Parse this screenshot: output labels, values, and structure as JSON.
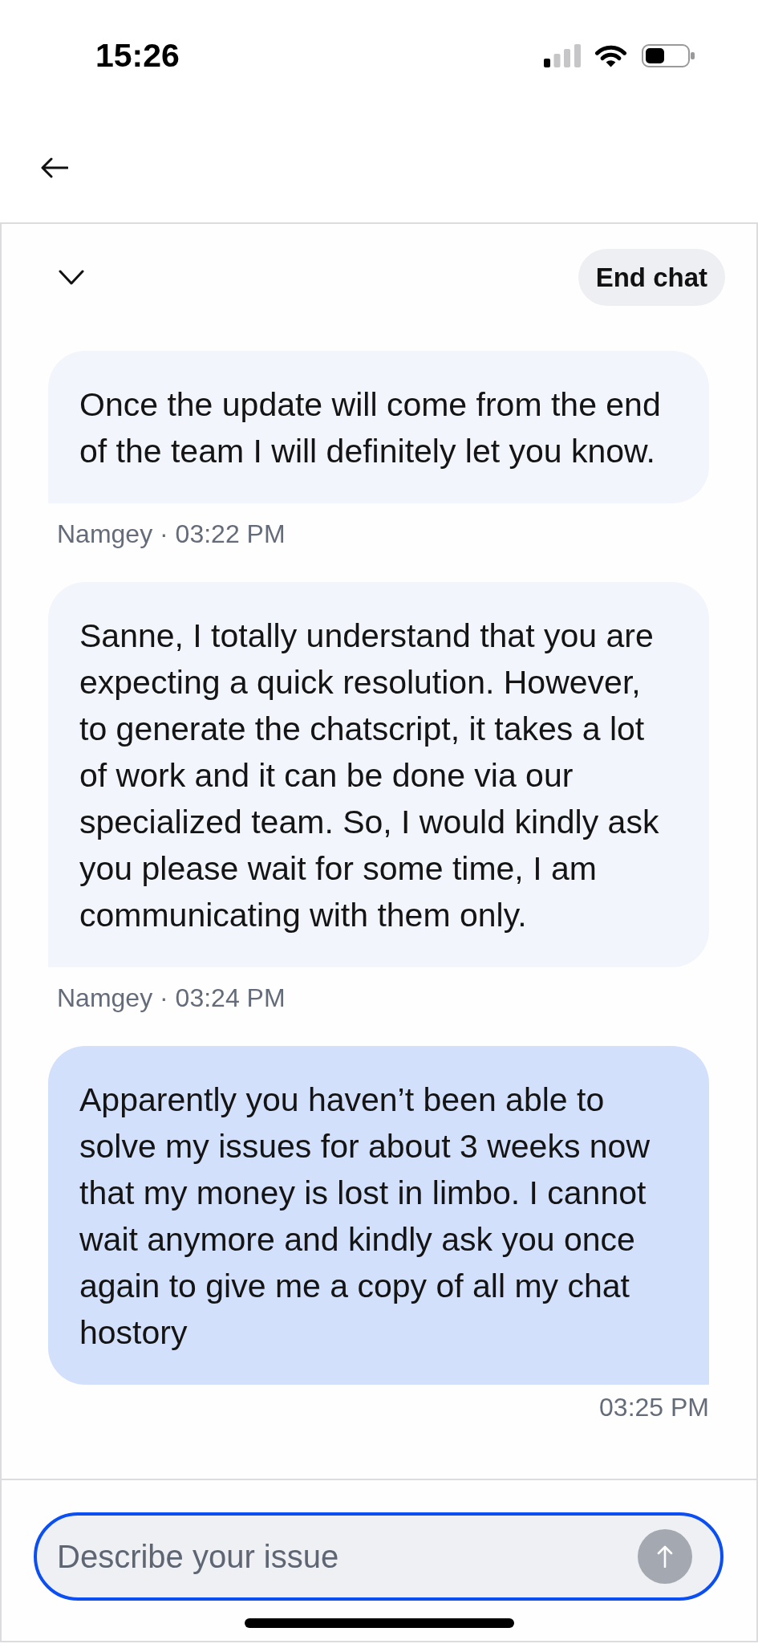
{
  "status_bar": {
    "time": "15:26"
  },
  "chat": {
    "end_button": "End chat"
  },
  "messages": [
    {
      "kind": "received",
      "text": "Once the update will come from the end of the team I will definitely let you know.",
      "meta": "Namgey · 03:22 PM"
    },
    {
      "kind": "received",
      "text": "Sanne, I totally understand that you are expecting a quick resolution. However, to generate the chatscript, it takes a lot of work and it can be done via our specialized team. So, I would kindly ask you please wait for some time, I am communicating with them only.",
      "meta": "Namgey · 03:24 PM"
    },
    {
      "kind": "sent",
      "text": "Apparently you haven’t been able to solve my issues for about 3 weeks now that my money is lost in limbo. I cannot wait anymore and kindly ask you once again to give me a copy of all my chat hostory",
      "meta": "03:25 PM"
    }
  ],
  "composer": {
    "placeholder": "Describe your issue",
    "focused": true,
    "send_button": {
      "disabled": true
    }
  }
}
